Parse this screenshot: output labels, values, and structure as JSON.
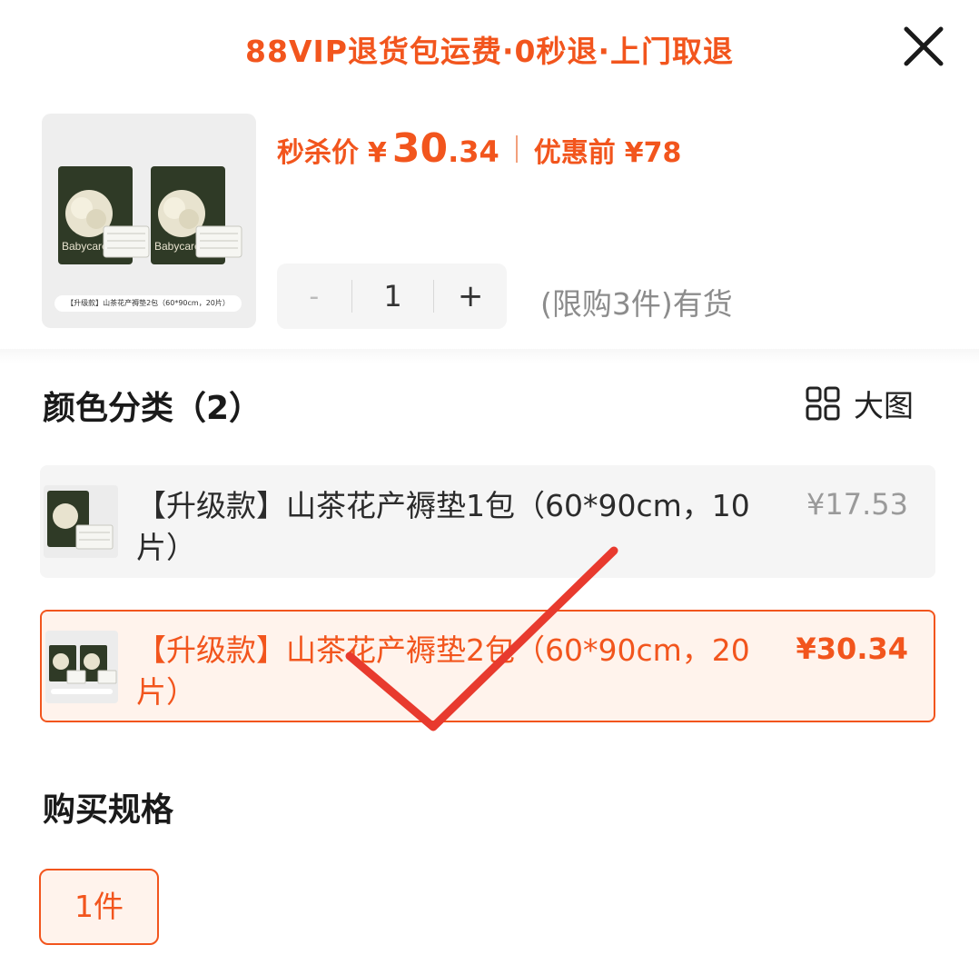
{
  "banner": {
    "text": "88VIP退货包运费·0秒退·上门取退"
  },
  "header": {
    "thumb_caption": "【升级款】山茶花产褥垫2包（60*90cm，20片）",
    "price_label": "秒杀价",
    "currency": "¥",
    "price_int": "30",
    "price_dec": ".34",
    "orig_label": "优惠前",
    "orig_price": "¥78",
    "brand": "Babycare"
  },
  "quantity": {
    "minus": "-",
    "value": "1",
    "plus": "+",
    "stock_note": "(限购3件)有货"
  },
  "color_section": {
    "title": "颜色分类（2）",
    "big_view_label": "大图",
    "options": [
      {
        "name": "【升级款】山茶花产褥垫1包（60*90cm，10片）",
        "price": "¥17.53",
        "selected": false
      },
      {
        "name": "【升级款】山茶花产褥垫2包（60*90cm，20片）",
        "price": "¥30.34",
        "selected": true
      }
    ]
  },
  "spec_section": {
    "title": "购买规格",
    "options": [
      {
        "label": "1件",
        "selected": true
      }
    ]
  },
  "colors": {
    "accent": "#f2551d",
    "check_mark": "#e83a2e",
    "selected_bg": "#fff3ec",
    "muted": "#8c8c8c"
  },
  "icons": {
    "close": "close-icon",
    "grid": "grid-icon",
    "check": "check-mark-icon"
  }
}
